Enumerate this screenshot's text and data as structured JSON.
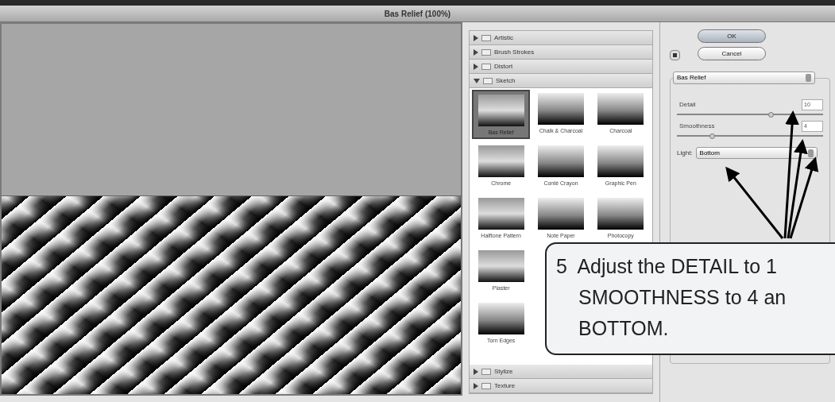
{
  "window": {
    "title": "Bas Relief (100%)"
  },
  "categories_above": [
    {
      "label": "Artistic",
      "expanded": false
    },
    {
      "label": "Brush Strokes",
      "expanded": false
    },
    {
      "label": "Distort",
      "expanded": false
    },
    {
      "label": "Sketch",
      "expanded": true
    }
  ],
  "thumbnails": [
    {
      "label": "Bas Relief",
      "selected": true
    },
    {
      "label": "Chalk & Charcoal",
      "selected": false
    },
    {
      "label": "Charcoal",
      "selected": false
    },
    {
      "label": "Chrome",
      "selected": false
    },
    {
      "label": "Conté Crayon",
      "selected": false
    },
    {
      "label": "Graphic Pen",
      "selected": false
    },
    {
      "label": "Halftone Pattern",
      "selected": false
    },
    {
      "label": "Note Paper",
      "selected": false
    },
    {
      "label": "Photocopy",
      "selected": false
    },
    {
      "label": "Plaster",
      "selected": false
    },
    {
      "label": "Torn Edges",
      "selected": false
    }
  ],
  "categories_below": [
    {
      "label": "Stylize",
      "expanded": false
    },
    {
      "label": "Texture",
      "expanded": false
    }
  ],
  "buttons": [
    "OK",
    "Cancel"
  ],
  "filter_select": "Bas Relief",
  "sliders": [
    {
      "label": "Detail",
      "value": "10",
      "level": 0.64
    },
    {
      "label": "Smoothness",
      "value": "4",
      "level": 0.24
    }
  ],
  "light": {
    "label": "Light:",
    "value": "Bottom"
  },
  "callout": {
    "lines": [
      "5  Adjust the DETAIL to 1",
      "SMOOTHNESS to 4 an",
      "BOTTOM."
    ]
  }
}
